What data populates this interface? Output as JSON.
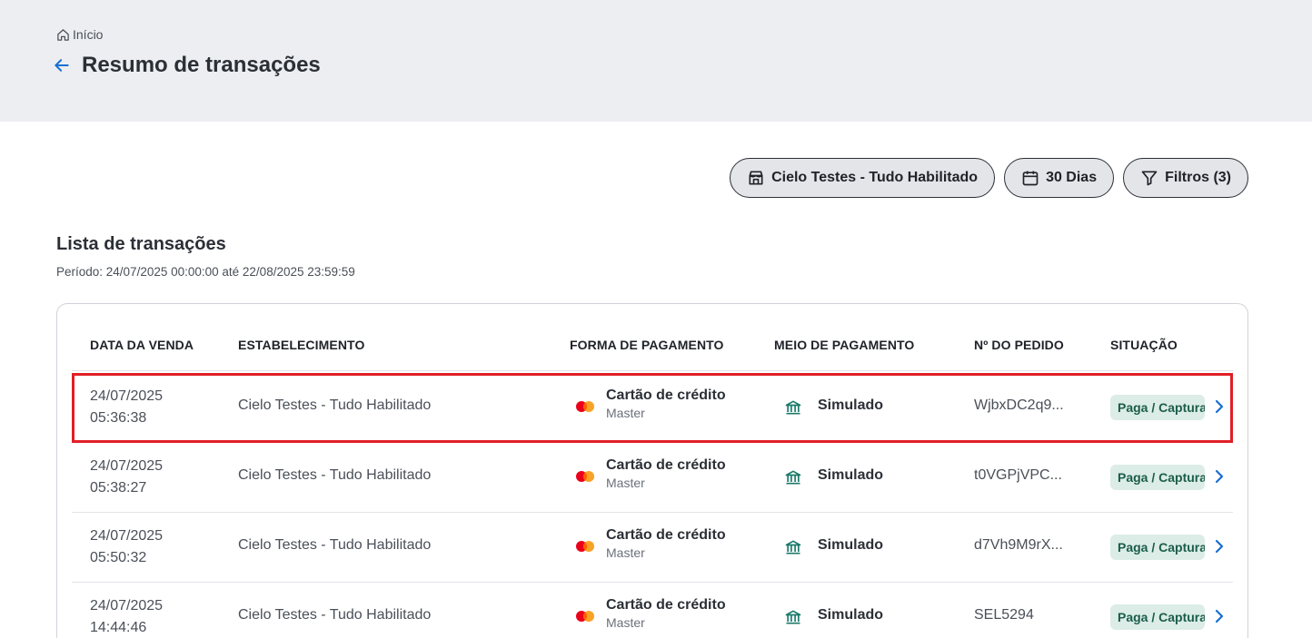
{
  "breadcrumb": {
    "home_label": "Início"
  },
  "header": {
    "title": "Resumo de transações"
  },
  "filters": {
    "establishment": "Cielo Testes - Tudo Habilitado",
    "period": "30 Dias",
    "filters": "Filtros (3)"
  },
  "list": {
    "title": "Lista de transações",
    "period": "Período: 24/07/2025 00:00:00 até 22/08/2025 23:59:59"
  },
  "table": {
    "columns": [
      "DATA DA VENDA",
      "ESTABELECIMENTO",
      "FORMA DE PAGAMENTO",
      "MEIO DE PAGAMENTO",
      "Nº DO PEDIDO",
      "SITUAÇÃO"
    ],
    "rows": [
      {
        "date": "24/07/2025",
        "time": "05:36:38",
        "establishment": "Cielo Testes - Tudo Habilitado",
        "payment_form": "Cartão de crédito",
        "brand": "Master",
        "payment_method": "Simulado",
        "order": "WjbxDC2q9...",
        "status": "Paga / Capturada",
        "highlighted": true
      },
      {
        "date": "24/07/2025",
        "time": "05:38:27",
        "establishment": "Cielo Testes - Tudo Habilitado",
        "payment_form": "Cartão de crédito",
        "brand": "Master",
        "payment_method": "Simulado",
        "order": "t0VGPjVPC...",
        "status": "Paga / Capturada",
        "highlighted": false
      },
      {
        "date": "24/07/2025",
        "time": "05:50:32",
        "establishment": "Cielo Testes - Tudo Habilitado",
        "payment_form": "Cartão de crédito",
        "brand": "Master",
        "payment_method": "Simulado",
        "order": "d7Vh9M9rX...",
        "status": "Paga / Capturada",
        "highlighted": false
      },
      {
        "date": "24/07/2025",
        "time": "14:44:46",
        "establishment": "Cielo Testes - Tudo Habilitado",
        "payment_form": "Cartão de crédito",
        "brand": "Master",
        "payment_method": "Simulado",
        "order": "SEL5294",
        "status": "Paga / Capturada",
        "highlighted": false
      }
    ]
  },
  "colors": {
    "accent": "#1a6fd1",
    "highlight": "#e01f26",
    "status_bg": "#dcece6",
    "status_text": "#1b5e4a",
    "bank_icon": "#1b7a6a"
  },
  "icons": [
    "home-icon",
    "back-arrow-icon",
    "store-icon",
    "calendar-icon",
    "filter-icon",
    "mastercard-icon",
    "bank-icon",
    "chevron-right-icon"
  ]
}
